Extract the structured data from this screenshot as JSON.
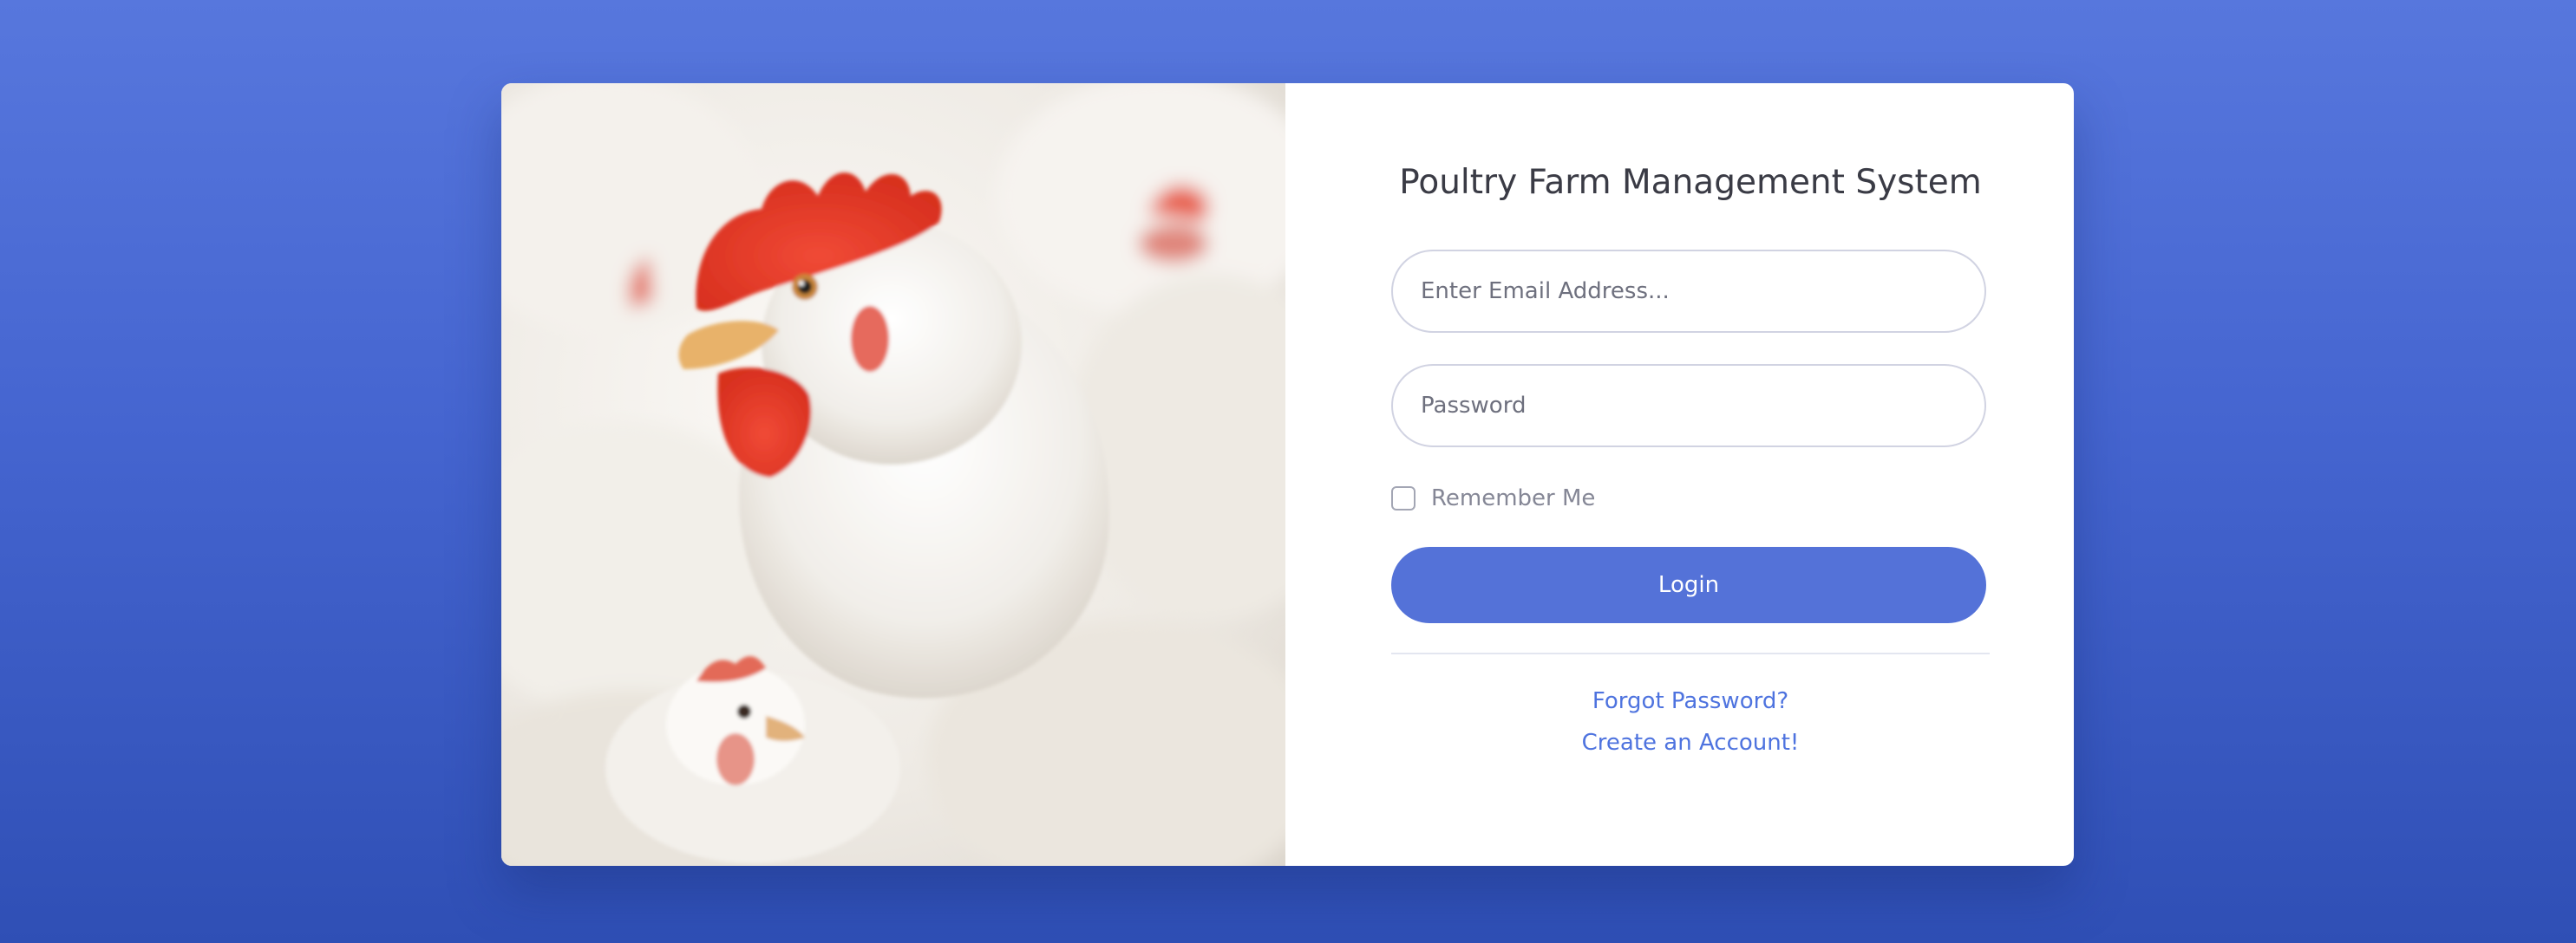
{
  "login": {
    "title": "Poultry Farm Management System",
    "email_placeholder": "Enter Email Address...",
    "password_placeholder": "Password",
    "remember_label": "Remember Me",
    "remember_checked": false,
    "login_label": "Login",
    "forgot_label": "Forgot Password?",
    "create_label": "Create an Account!"
  },
  "colors": {
    "background": "#4565d0",
    "primary": "#5472d8",
    "link": "#4e73df",
    "title_text": "#3a3b45",
    "muted_text": "#858796"
  },
  "image": {
    "subject": "white chickens"
  }
}
